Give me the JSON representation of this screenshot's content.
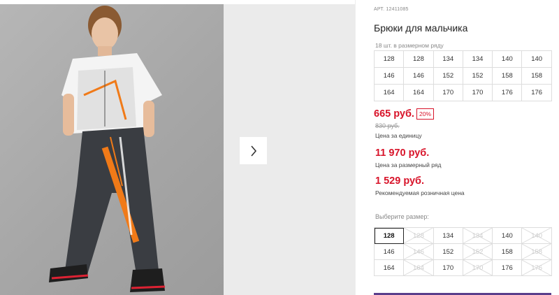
{
  "product": {
    "article": "АРТ. 12411085",
    "title": "Брюки для мальчика"
  },
  "size_range": {
    "caption": "18 шт. в размерном ряду",
    "cells": [
      "128",
      "128",
      "134",
      "134",
      "140",
      "140",
      "146",
      "146",
      "152",
      "152",
      "158",
      "158",
      "164",
      "164",
      "170",
      "170",
      "176",
      "176"
    ]
  },
  "pricing": {
    "unit_price": "665 руб.",
    "discount": "20%",
    "old_price": "830 руб.",
    "unit_caption": "Цена за единицу",
    "range_price": "11 970 руб.",
    "range_caption": "Цена за размерный ряд",
    "retail_price": "1 529 руб.",
    "retail_caption": "Рекомендуемая розничная цена"
  },
  "size_picker": {
    "caption": "Выберите размер:",
    "sizes": [
      {
        "label": "128",
        "state": "selected"
      },
      {
        "label": "128",
        "state": "disabled"
      },
      {
        "label": "134",
        "state": "available"
      },
      {
        "label": "134",
        "state": "disabled"
      },
      {
        "label": "140",
        "state": "available"
      },
      {
        "label": "140",
        "state": "disabled"
      },
      {
        "label": "146",
        "state": "available"
      },
      {
        "label": "146",
        "state": "disabled"
      },
      {
        "label": "152",
        "state": "available"
      },
      {
        "label": "152",
        "state": "disabled"
      },
      {
        "label": "158",
        "state": "available"
      },
      {
        "label": "158",
        "state": "disabled"
      },
      {
        "label": "164",
        "state": "available"
      },
      {
        "label": "164",
        "state": "disabled"
      },
      {
        "label": "170",
        "state": "available"
      },
      {
        "label": "170",
        "state": "disabled"
      },
      {
        "label": "176",
        "state": "available"
      },
      {
        "label": "176",
        "state": "disabled"
      }
    ]
  },
  "gallery": {
    "next_icon": "chevron-right-icon"
  },
  "colors": {
    "price_red": "#d8142a",
    "accent_purple": "#5a3e8c"
  }
}
